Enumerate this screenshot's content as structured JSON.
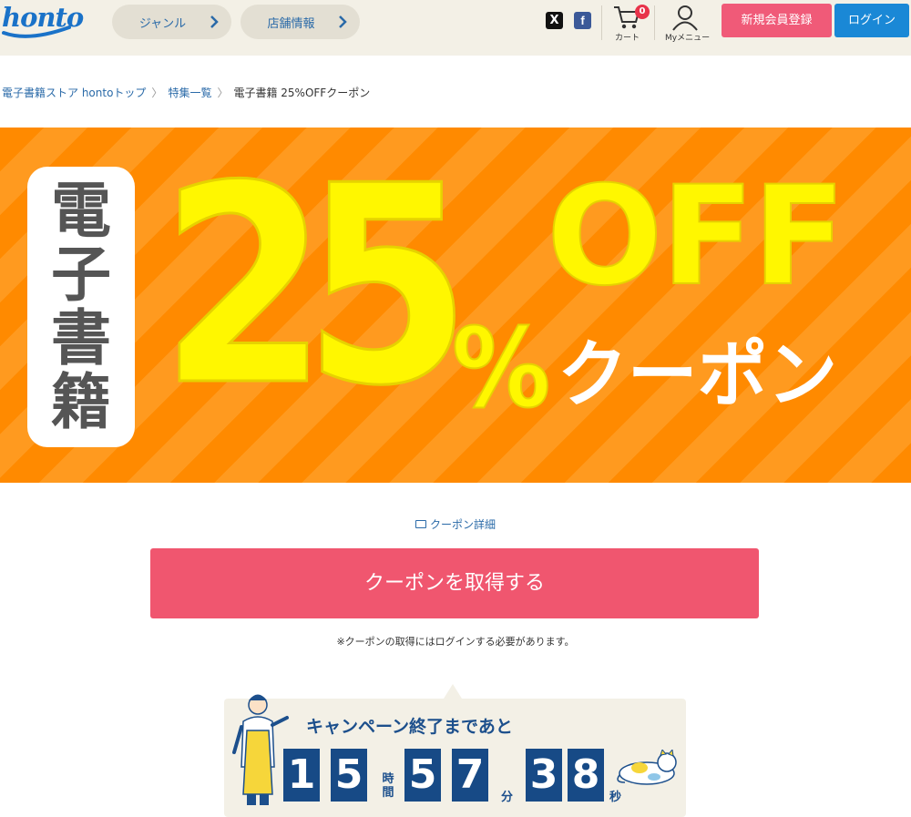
{
  "header": {
    "logo_text": "honto",
    "nav": [
      {
        "label": "ジャンル"
      },
      {
        "label": "店舗情報"
      }
    ],
    "sns": {
      "x": "X",
      "facebook": "f"
    },
    "cart": {
      "count": "0",
      "caption": "カート"
    },
    "mymenu": {
      "caption": "Myメニュー"
    },
    "register_label": "新規会員登録",
    "login_label": "ログイン"
  },
  "breadcrumb": {
    "items": [
      {
        "label": "電子書籍ストア hontoトップ"
      },
      {
        "label": "特集一覧"
      }
    ],
    "separator": "〉",
    "current": "電子書籍 25%OFFクーポン"
  },
  "banner": {
    "vertical_text": "電\n子\n書\n籍",
    "big_number": "25",
    "percent": "%",
    "off": "OFF",
    "coupon_word": "クーポン",
    "colors": {
      "orange": "#ff8a00",
      "yellow": "#fff700"
    }
  },
  "coupon": {
    "detail_link": "クーポン詳細",
    "get_button": "クーポンを取得する",
    "note": "※クーポンの取得にはログインする必要があります。"
  },
  "countdown": {
    "title": "キャンペーン終了まであと",
    "hours": [
      "1",
      "5"
    ],
    "hours_unit": "時間",
    "minutes": [
      "5",
      "7"
    ],
    "minutes_unit": "分",
    "seconds": [
      "3",
      "8"
    ],
    "seconds_unit": "秒"
  }
}
